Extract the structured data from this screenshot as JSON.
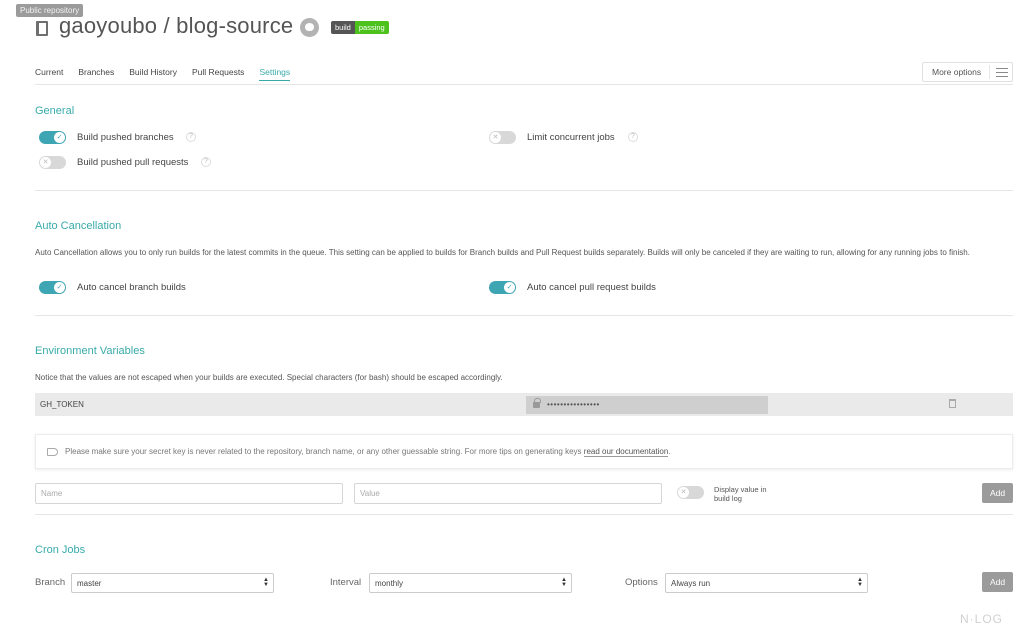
{
  "header": {
    "tooltip": "Public repository",
    "repo_title": "gaoyoubo / blog-source",
    "badge_left": "build",
    "badge_right": "passing"
  },
  "tabs": [
    {
      "label": "Current"
    },
    {
      "label": "Branches"
    },
    {
      "label": "Build History"
    },
    {
      "label": "Pull Requests"
    },
    {
      "label": "Settings",
      "active": true
    }
  ],
  "more_options": "More options",
  "general": {
    "title": "General",
    "build_pushed_branches": {
      "label": "Build pushed branches",
      "on": true
    },
    "build_pushed_prs": {
      "label": "Build pushed pull requests",
      "on": false
    },
    "limit_concurrent": {
      "label": "Limit concurrent jobs",
      "on": false
    },
    "help": "?"
  },
  "auto_cancel": {
    "title": "Auto Cancellation",
    "description": "Auto Cancellation allows you to only run builds for the latest commits in the queue. This setting can be applied to builds for Branch builds and Pull Request builds separately. Builds will only be canceled if they are waiting to run, allowing for any running jobs to finish.",
    "branch": {
      "label": "Auto cancel branch builds",
      "on": true
    },
    "pr": {
      "label": "Auto cancel pull request builds",
      "on": true
    }
  },
  "env": {
    "title": "Environment Variables",
    "notice": "Notice that the values are not escaped when your builds are executed. Special characters (for bash) should be escaped accordingly.",
    "variables": [
      {
        "name": "GH_TOKEN",
        "value": "••••••••••••••••"
      }
    ],
    "tip_text": "Please make sure your secret key is never related to the repository, branch name, or any other guessable string. For more tips on generating keys",
    "tip_link": "read our documentation",
    "tip_end": ".",
    "name_placeholder": "Name",
    "value_placeholder": "Value",
    "display_label_1": "Display value in",
    "display_label_2": "build log",
    "add": "Add"
  },
  "cron": {
    "title": "Cron Jobs",
    "branch_label": "Branch",
    "branch_value": "master",
    "interval_label": "Interval",
    "interval_value": "monthly",
    "options_label": "Options",
    "options_value": "Always run",
    "add": "Add"
  },
  "watermark": "N·LOG",
  "colors": {
    "accent": "#39aaaa",
    "toggle_on": "#3ea5b3",
    "badge_pass": "#4dc21d"
  }
}
